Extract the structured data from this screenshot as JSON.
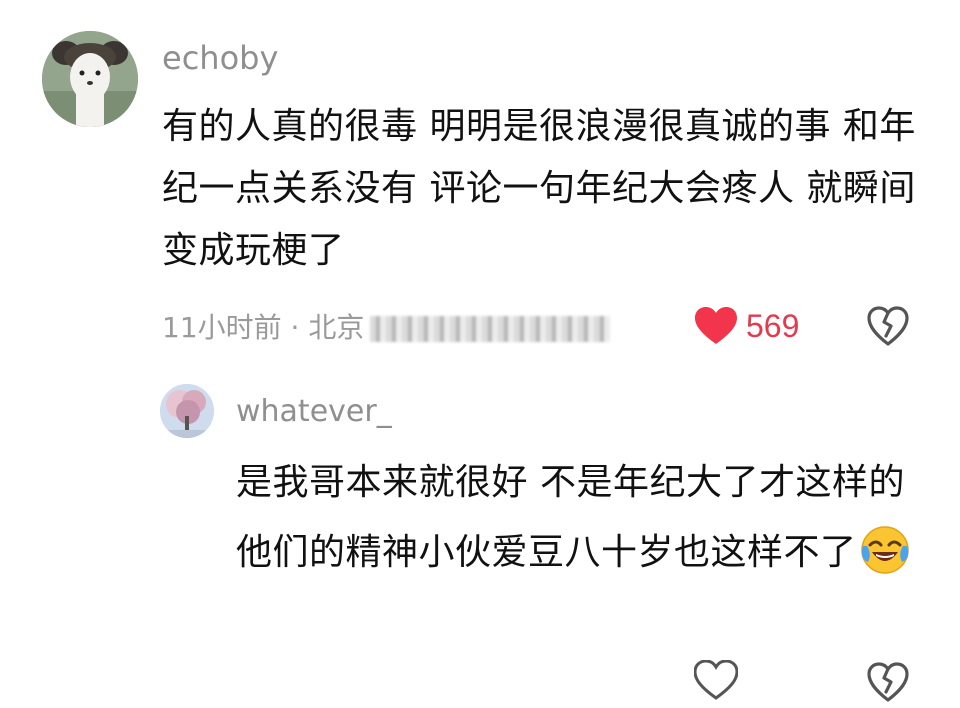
{
  "comment": {
    "username": "echoby",
    "text": "有的人真的很毒 明明是很浪漫很真诚的事 和年纪一点关系没有 评论一句年纪大会疼人 就瞬间变成玩梗了",
    "meta": "11小时前 · 北京",
    "likes": "569",
    "like_color": "#e23b4e",
    "avatar_icon": "cat-avatar-icon",
    "like_icon": "heart-filled-icon",
    "dislike_icon": "broken-heart-icon"
  },
  "reply": {
    "username": "whatever_",
    "text": "是我哥本来就很好 不是年纪大了才这样的 他们的精神小伙爱豆八十岁也这样不了",
    "emoji": "crying-laughing-emoji",
    "avatar_icon": "tree-avatar-icon",
    "like_icon": "heart-outline-icon",
    "dislike_icon": "broken-heart-icon"
  }
}
